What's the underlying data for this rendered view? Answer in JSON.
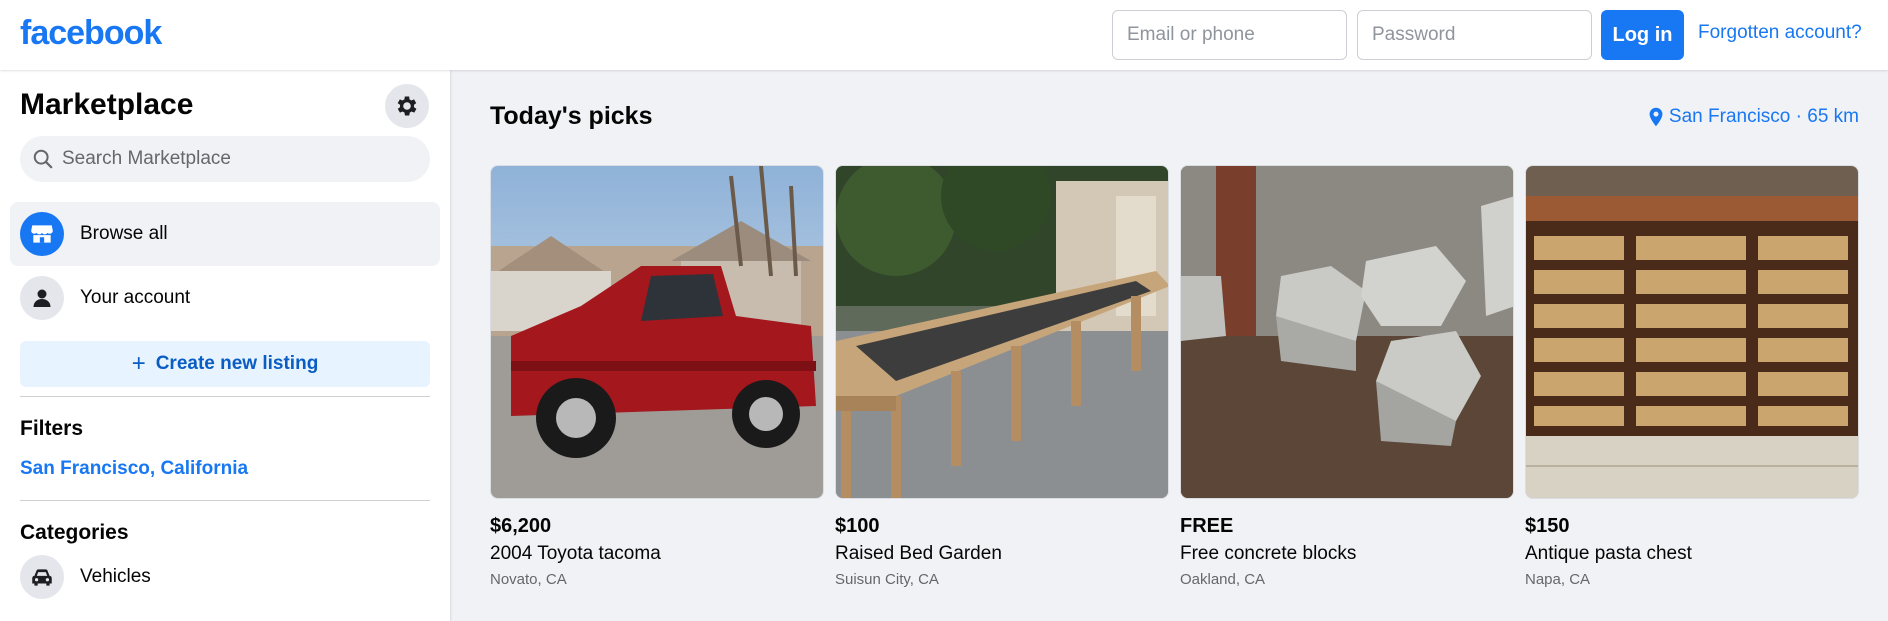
{
  "header": {
    "logo": "facebook",
    "email_placeholder": "Email or phone",
    "password_placeholder": "Password",
    "login_label": "Log in",
    "forgot_label": "Forgotten account?"
  },
  "sidebar": {
    "title": "Marketplace",
    "settings_icon": "gear-icon",
    "search_placeholder": "Search Marketplace",
    "nav": [
      {
        "label": "Browse all",
        "icon": "storefront-icon",
        "active": true
      },
      {
        "label": "Your account",
        "icon": "person-icon",
        "active": false
      }
    ],
    "create_label": "Create new listing",
    "filters_heading": "Filters",
    "filter_location": "San Francisco, California",
    "categories_heading": "Categories",
    "categories": [
      {
        "label": "Vehicles",
        "icon": "car-icon"
      }
    ]
  },
  "main": {
    "title": "Today's picks",
    "location": "San Francisco · 65 km",
    "listings": [
      {
        "price": "$6,200",
        "title": "2004 Toyota tacoma",
        "location": "Novato, CA"
      },
      {
        "price": "$100",
        "title": "Raised Bed Garden",
        "location": "Suisun City, CA"
      },
      {
        "price": "FREE",
        "title": "Free concrete blocks",
        "location": "Oakland, CA"
      },
      {
        "price": "$150",
        "title": "Antique pasta chest",
        "location": "Napa, CA"
      }
    ]
  },
  "colors": {
    "brand": "#1877f2",
    "page_bg": "#f0f2f5",
    "create_bg": "#e7f3ff"
  }
}
